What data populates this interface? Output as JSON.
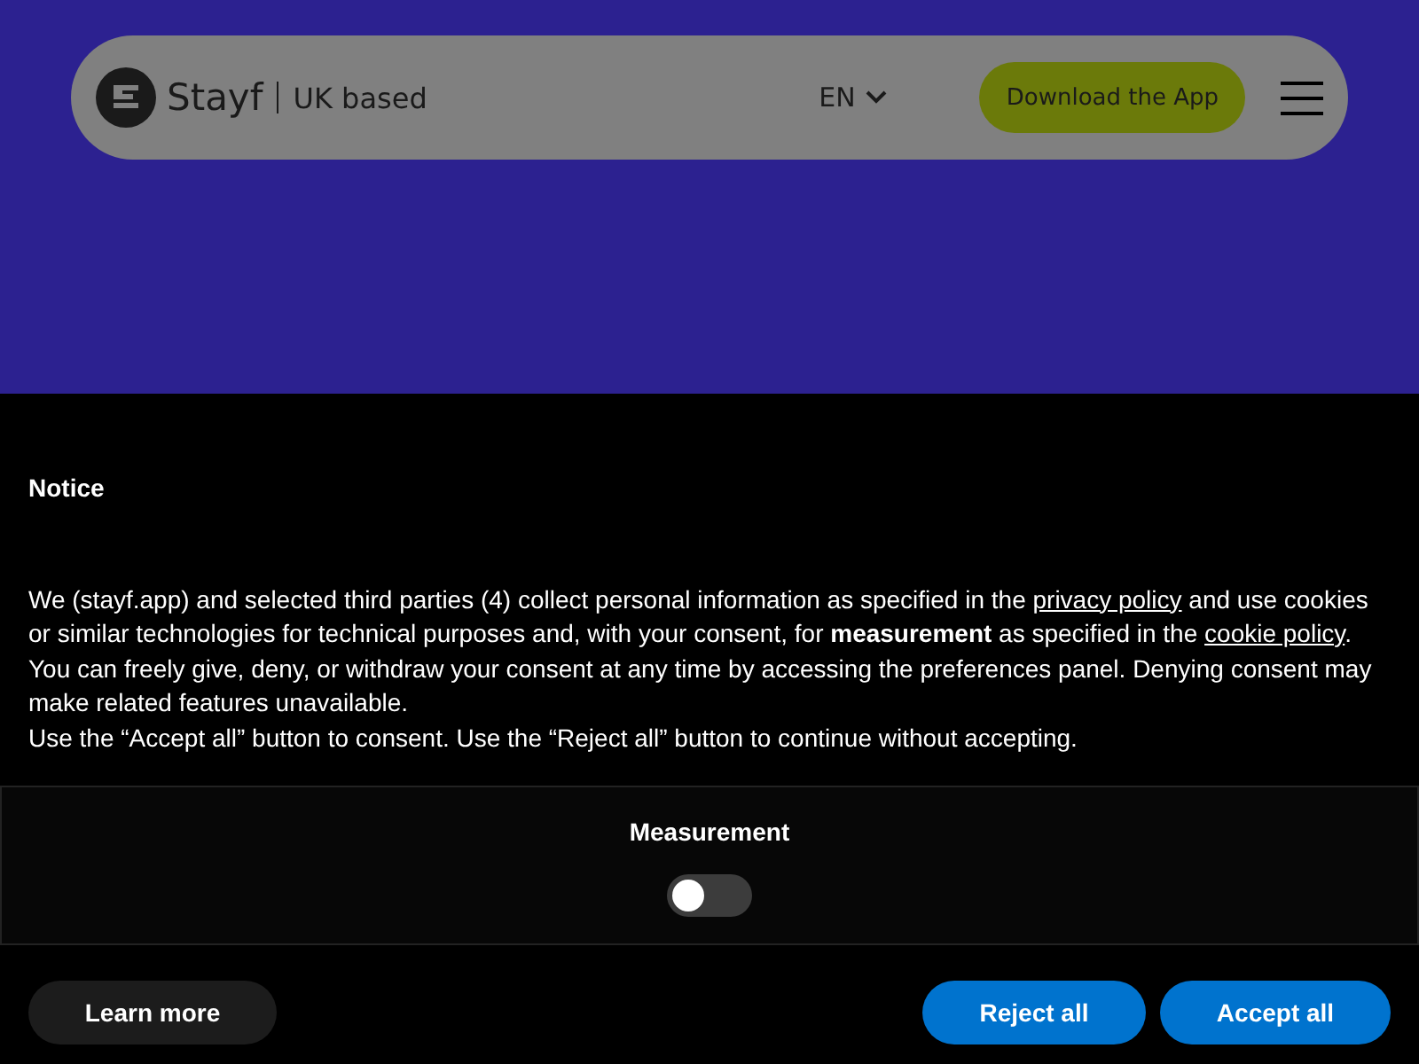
{
  "header": {
    "brand": "Stayf",
    "tagline": "UK based",
    "language": "EN",
    "download_button": "Download the App"
  },
  "notice": {
    "title": "Notice",
    "paragraphs": [
      [
        {
          "kind": "text",
          "text": "We (stayf.app) and selected third parties (4) collect personal information as specified in the "
        },
        {
          "kind": "link",
          "text": "privacy policy"
        },
        {
          "kind": "text",
          "text": " and use cookies or similar technologies for technical purposes and, with your consent, for **measurement** as specified in the "
        },
        {
          "kind": "link",
          "text": "cookie policy"
        },
        {
          "kind": "text",
          "text": ". You can freely give, deny, or withdraw your consent at any time by accessing the preferences panel. Denying consent may make related features unavailable."
        }
      ],
      [
        {
          "kind": "text",
          "text": "Use the “Accept all” button to consent. Use the “Reject all” button to continue without accepting."
        }
      ]
    ],
    "purpose": {
      "label": "Measurement",
      "on": false
    },
    "buttons": [
      {
        "label": "Learn more",
        "kind": "secondary"
      },
      {
        "label": "Reject all",
        "kind": "primary"
      },
      {
        "label": "Accept all",
        "kind": "primary"
      }
    ]
  }
}
